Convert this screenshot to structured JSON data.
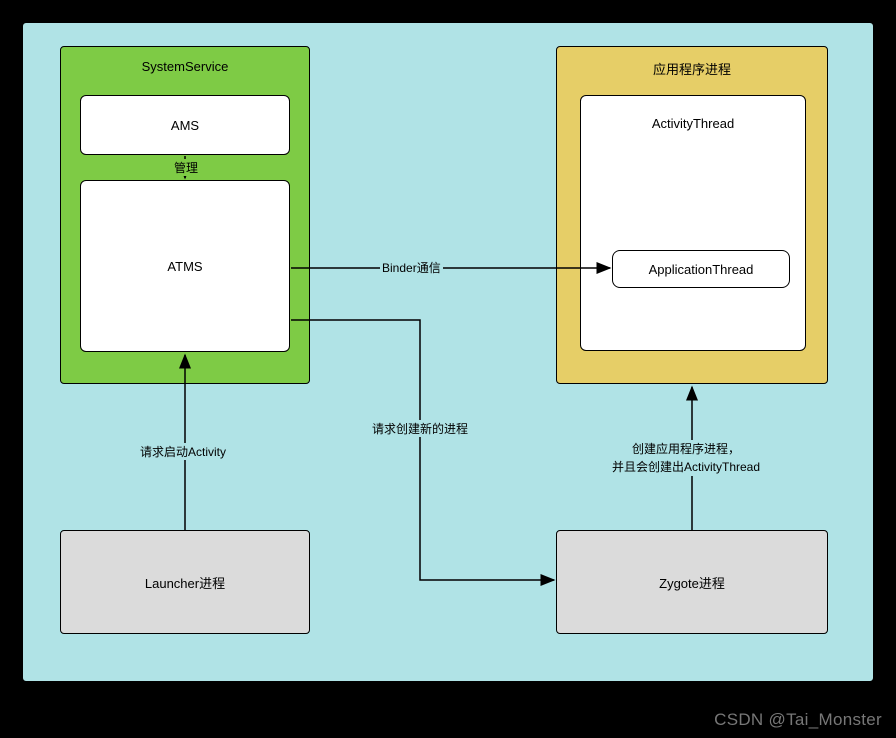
{
  "containers": {
    "systemService": {
      "title": "SystemService"
    },
    "appProcess": {
      "title": "应用程序进程"
    }
  },
  "nodes": {
    "ams": {
      "label": "AMS"
    },
    "atms": {
      "label": "ATMS"
    },
    "activityThread": {
      "label": "ActivityThread"
    },
    "applicationThread": {
      "label": "ApplicationThread"
    },
    "launcher": {
      "label": "Launcher进程"
    },
    "zygote": {
      "label": "Zygote进程"
    }
  },
  "edges": {
    "amsToAtms": {
      "label": "管理"
    },
    "atmsToAppThread": {
      "label": "Binder通信"
    },
    "launcherToAtms": {
      "label": "请求启动Activity"
    },
    "atmsToZygote": {
      "label": "请求创建新的进程"
    },
    "zygoteToAppProcess": {
      "label": "创建应用程序进程，\n并且会创建出ActivityThread"
    }
  },
  "watermark": "CSDN @Tai_Monster"
}
